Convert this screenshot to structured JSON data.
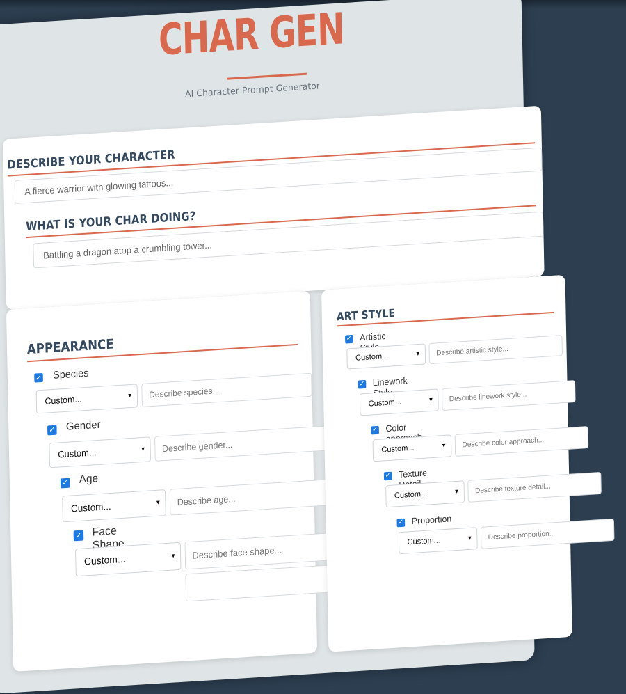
{
  "header": {
    "title": "CHAR GEN",
    "subtitle": "AI Character Prompt Generator"
  },
  "describe": {
    "heading": "DESCRIBE YOUR CHARACTER",
    "placeholder": "A fierce warrior with glowing tattoos..."
  },
  "doing": {
    "heading": "WHAT IS YOUR CHAR DOING?",
    "placeholder": "Battling a dragon atop a crumbling tower..."
  },
  "appearance": {
    "heading": "APPEARANCE",
    "items": [
      {
        "label": "Species",
        "select": "Custom...",
        "placeholder": "Describe species..."
      },
      {
        "label": "Gender",
        "select": "Custom...",
        "placeholder": "Describe gender..."
      },
      {
        "label": "Age",
        "select": "Custom...",
        "placeholder": "Describe age..."
      },
      {
        "label": "Face Shape",
        "select": "Custom...",
        "placeholder": "Describe face shape..."
      }
    ]
  },
  "art_style": {
    "heading": "ART STYLE",
    "items": [
      {
        "label": "Artistic Style",
        "select": "Custom...",
        "placeholder": "Describe artistic style..."
      },
      {
        "label": "Linework Style",
        "select": "Custom...",
        "placeholder": "Describe linework style..."
      },
      {
        "label": "Color approach",
        "select": "Custom...",
        "placeholder": "Describe color approach..."
      },
      {
        "label": "Texture Detail",
        "select": "Custom...",
        "placeholder": "Describe texture detail..."
      },
      {
        "label": "Proportion",
        "select": "Custom...",
        "placeholder": "Describe proportion..."
      }
    ]
  },
  "colors": {
    "accent": "#d9694e",
    "heading": "#34495e",
    "background": "#2c3e50",
    "checkbox": "#1f7ae0"
  }
}
